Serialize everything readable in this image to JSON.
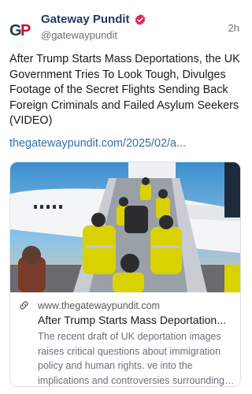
{
  "post": {
    "author": {
      "display_name": "Gateway Pundit",
      "handle": "@gatewaypundit",
      "avatar_text": "GP",
      "verified": true
    },
    "timestamp": "2h",
    "body_text": "After Trump Starts Mass Deportations, the UK Government Tries To Look Tough, Divulges Footage of the Secret Flights Sending Back Foreign Criminals and Failed Asylum Seekers (VIDEO)",
    "link_text": "thegatewaypundit.com/2025/02/a..."
  },
  "card": {
    "domain": "www.thegatewaypundit.com",
    "title": "After Trump Starts Mass Deportation...",
    "description": "The recent draft of UK deportation images raises critical questions about immigration policy and human rights. ve into the implications and controversies surrounding ..."
  },
  "icons": {
    "verified": "verified-badge-icon",
    "link": "link-icon"
  },
  "colors": {
    "display_name": "#1e3a5f",
    "verified_badge": "#e0245e",
    "link": "#2f6fb0",
    "secondary_text": "#6a6f78"
  }
}
